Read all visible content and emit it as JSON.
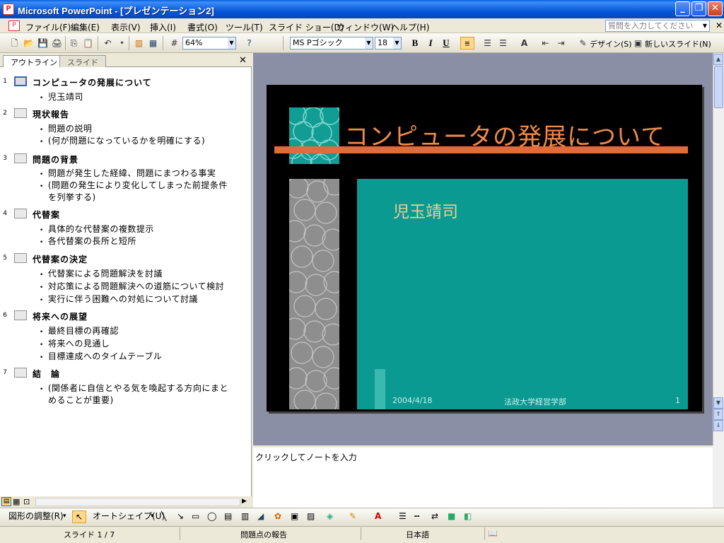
{
  "window": {
    "title": "Microsoft PowerPoint - [プレゼンテーション2]",
    "help_placeholder": "質問を入力してください"
  },
  "menu": [
    "ファイル(F)",
    "編集(E)",
    "表示(V)",
    "挿入(I)",
    "書式(O)",
    "ツール(T)",
    "スライド ショー(D)",
    "ウィンドウ(W)",
    "ヘルプ(H)"
  ],
  "toolbar": {
    "zoom": "64%",
    "font_name": "MS Pゴシック",
    "font_size": "18",
    "bold": "B",
    "italic": "I",
    "underline": "U",
    "design_label": "デザイン(S)",
    "new_slide_label": "新しいスライド(N)"
  },
  "left_pane": {
    "tabs": [
      "アウトライン",
      "スライド"
    ],
    "active_tab": "アウトライン"
  },
  "outline": [
    {
      "num": "1",
      "title": "コンピュータの発展について",
      "subtitle": "児玉靖司",
      "bullets": []
    },
    {
      "num": "2",
      "title": "現状報告",
      "bullets": [
        "問題の説明",
        "(何が問題になっているかを明確にする)"
      ]
    },
    {
      "num": "3",
      "title": "問題の背景",
      "bullets": [
        "問題が発生した経緯、問題にまつわる事実",
        "(問題の発生により変化してしまった前提条件",
        "を列挙する)"
      ]
    },
    {
      "num": "4",
      "title": "代替案",
      "bullets": [
        "具体的な代替案の複数提示",
        "各代替案の長所と短所"
      ]
    },
    {
      "num": "5",
      "title": "代替案の決定",
      "bullets": [
        "代替案による問題解決を討議",
        "対応策による問題解決への道筋について検討",
        "実行に伴う困難への対処について討議"
      ]
    },
    {
      "num": "6",
      "title": "将来への展望",
      "bullets": [
        "最終目標の再確認",
        "将来への見通し",
        "目標達成へのタイムテーブル"
      ]
    },
    {
      "num": "7",
      "title": "結　論",
      "bullets": [
        "(関係者に自信とやる気を喚起する方向にまと",
        "めることが重要)"
      ]
    }
  ],
  "slide": {
    "title": "コンピュータの発展について",
    "subtitle": "児玉靖司",
    "date": "2004/4/18",
    "footer": "法政大学経営学部",
    "number": "1"
  },
  "notes_placeholder": "クリックしてノートを入力",
  "drawing": {
    "adjust_label": "図形の調整(R)",
    "autoshape_label": "オートシェイプ(U)"
  },
  "status": {
    "slide_info": "スライド 1 / 7",
    "design_name": "問題点の報告",
    "language": "日本語"
  },
  "colors": {
    "slide_background": "#000000",
    "title_text": "#f08a48",
    "accent_line": "#e36a3b",
    "body_panel": "#0a9a92",
    "subtitle_text": "#f0cd90"
  }
}
